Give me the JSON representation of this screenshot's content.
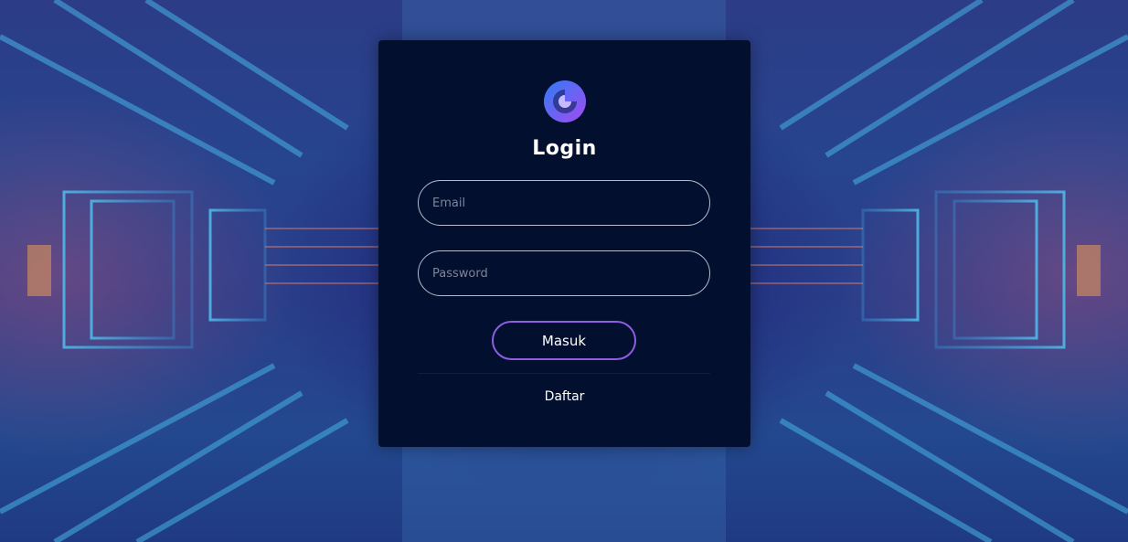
{
  "login": {
    "title": "Login",
    "email_placeholder": "Email",
    "password_placeholder": "Password",
    "submit_label": "Masuk",
    "register_label": "Daftar"
  },
  "colors": {
    "card_bg": "#020f2f",
    "button_border": "#8e5de0",
    "logo_gradient_start": "#2f7cf6",
    "logo_gradient_end": "#a34bf0"
  },
  "icons": {
    "logo": "swirl-logo-icon"
  }
}
